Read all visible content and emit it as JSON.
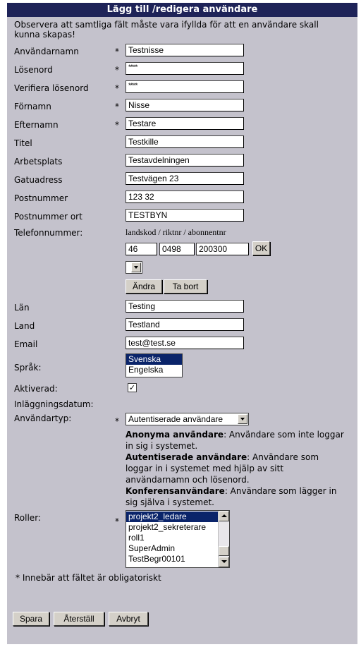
{
  "title": "Lägg till /redigera användare",
  "intro": "Observera att samtliga fält måste vara ifyllda för att en användare skall kunna skapas!",
  "required_marker": "*",
  "fields": {
    "username": {
      "label": "Användarnamn",
      "value": "Testnisse"
    },
    "password": {
      "label": "Lösenord",
      "value": "*****"
    },
    "verify_password": {
      "label": "Verifiera lösenord",
      "value": "*****"
    },
    "firstname": {
      "label": "Förnamn",
      "value": "Nisse"
    },
    "lastname": {
      "label": "Efternamn",
      "value": "Testare"
    },
    "title": {
      "label": "Titel",
      "value": "Testkille"
    },
    "workplace": {
      "label": "Arbetsplats",
      "value": "Testavdelningen"
    },
    "street": {
      "label": "Gatuadress",
      "value": "Testvägen 23"
    },
    "postcode": {
      "label": "Postnummer",
      "value": "123 32"
    },
    "city": {
      "label": "Postnummer ort",
      "value": "TESTBYN"
    },
    "county": {
      "label": "Län",
      "value": "Testing"
    },
    "country": {
      "label": "Land",
      "value": "Testland"
    },
    "email": {
      "label": "Email",
      "value": "test@test.se"
    }
  },
  "phone": {
    "label": "Telefonnummer:",
    "hint": "landskod / riktnr / abonnentnr",
    "country_code": "46",
    "area_code": "0498",
    "number": "200300",
    "ok_label": "OK",
    "change_label": "Ändra",
    "remove_label": "Ta bort"
  },
  "language": {
    "label": "Språk:",
    "options": [
      "Svenska",
      "Engelska"
    ],
    "selected": "Svenska"
  },
  "activated": {
    "label": "Aktiverad:",
    "checked": true,
    "mark": "✓"
  },
  "created_date": {
    "label": "Inläggningsdatum:"
  },
  "user_type": {
    "label": "Användartyp:",
    "selected": "Autentiserade användare",
    "descriptions": [
      {
        "term": "Anonyma användare",
        "text": ": Användare som inte loggar in sig i systemet."
      },
      {
        "term": "Autentiserade användare",
        "text": ": Användare som loggar in i systemet med hjälp av sitt användarnamn och lösenord."
      },
      {
        "term": "Konferensanvändare",
        "text": ": Användare som lägger in sig själva i systemet."
      }
    ]
  },
  "roles": {
    "label": "Roller:",
    "options": [
      "projekt2_ledare",
      "projekt2_sekreterare",
      "roll1",
      "SuperAdmin",
      "TestBegr00101"
    ],
    "selected": "projekt2_ledare"
  },
  "footnote": "* Innebär att fältet är obligatoriskt",
  "actions": {
    "save": "Spara",
    "reset": "Återställ",
    "cancel": "Avbryt"
  }
}
